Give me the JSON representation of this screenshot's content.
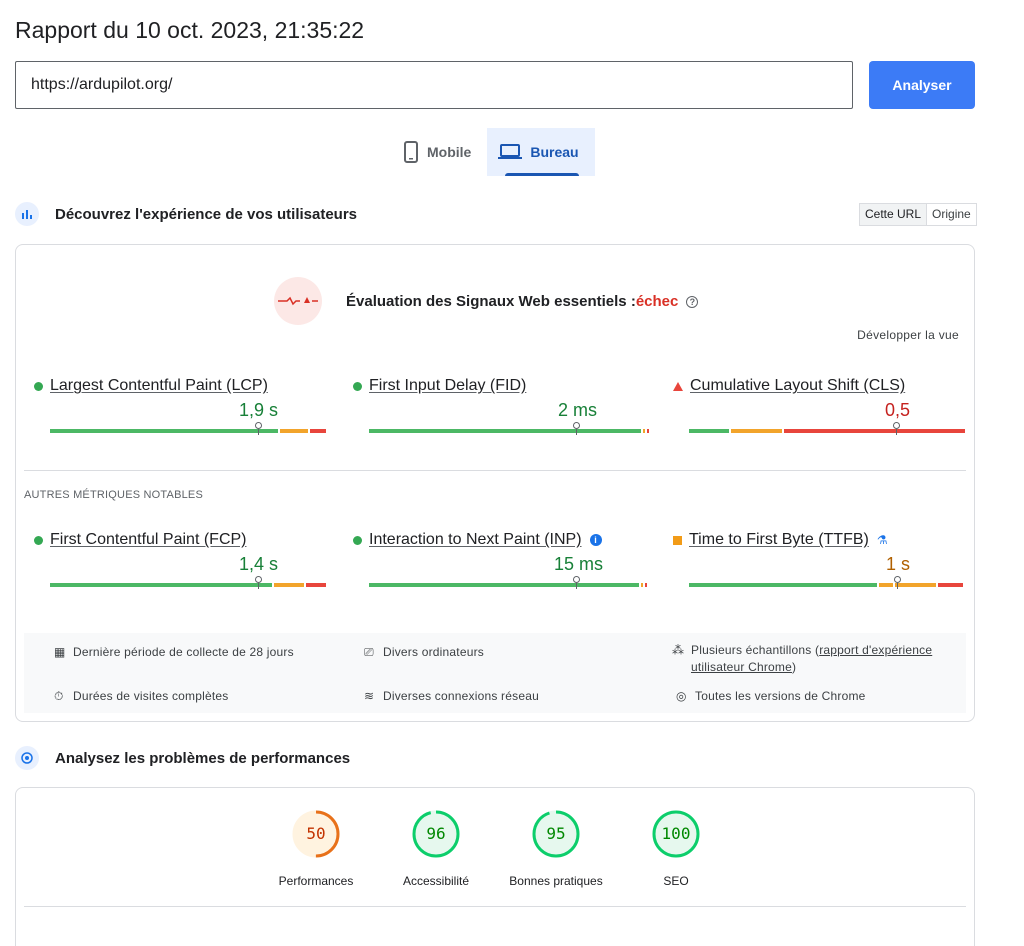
{
  "header": {
    "title": "Rapport du 10 oct. 2023, 21:35:22",
    "url_value": "https://ardupilot.org/",
    "analyze_label": "Analyser"
  },
  "device_tabs": [
    {
      "label": "Mobile",
      "icon": "phone-icon",
      "active": false
    },
    {
      "label": "Bureau",
      "icon": "laptop-icon",
      "active": true
    }
  ],
  "experience": {
    "title": "Découvrez l'expérience de vos utilisateurs",
    "toggle": [
      "Cette URL",
      "Origine"
    ],
    "cwv_assessment": "Évaluation des Signaux Web essentiels :",
    "cwv_result": "échec",
    "expand_label": "Développer la vue",
    "others_label": "AUTRES MÉTRIQUES NOTABLES",
    "core_metrics": [
      {
        "name": "Largest Contentful Paint (LCP)",
        "value": "1,9 s",
        "status": "good"
      },
      {
        "name": "First Input Delay (FID)",
        "value": "2 ms",
        "status": "good"
      },
      {
        "name": "Cumulative Layout Shift (CLS)",
        "value": "0,5",
        "status": "poor"
      }
    ],
    "other_metrics": [
      {
        "name": "First Contentful Paint (FCP)",
        "value": "1,4 s",
        "status": "good"
      },
      {
        "name": "Interaction to Next Paint (INP)",
        "value": "15 ms",
        "status": "good"
      },
      {
        "name": "Time to First Byte (TTFB)",
        "value": "1 s",
        "status": "needs-improvement"
      }
    ],
    "info_items": {
      "period": "Dernière période de collecte de 28 jours",
      "devices": "Divers ordinateurs",
      "samples_prefix": "Plusieurs échantillons (",
      "samples_link": "rapport d'expérience utilisateur Chrome",
      "samples_suffix": ")",
      "durations": "Durées de visites complètes",
      "network": "Diverses connexions réseau",
      "versions": "Toutes les versions de Chrome"
    }
  },
  "performance": {
    "title": "Analysez les problèmes de performances",
    "scores": [
      {
        "label": "Performances",
        "score": "50",
        "color": "#e8711a",
        "fill": 0.5
      },
      {
        "label": "Accessibilité",
        "score": "96",
        "color": "#0cce6b",
        "fill": 0.96
      },
      {
        "label": "Bonnes pratiques",
        "score": "95",
        "color": "#0cce6b",
        "fill": 0.95
      },
      {
        "label": "SEO",
        "score": "100",
        "color": "#0cce6b",
        "fill": 1.0
      }
    ]
  }
}
